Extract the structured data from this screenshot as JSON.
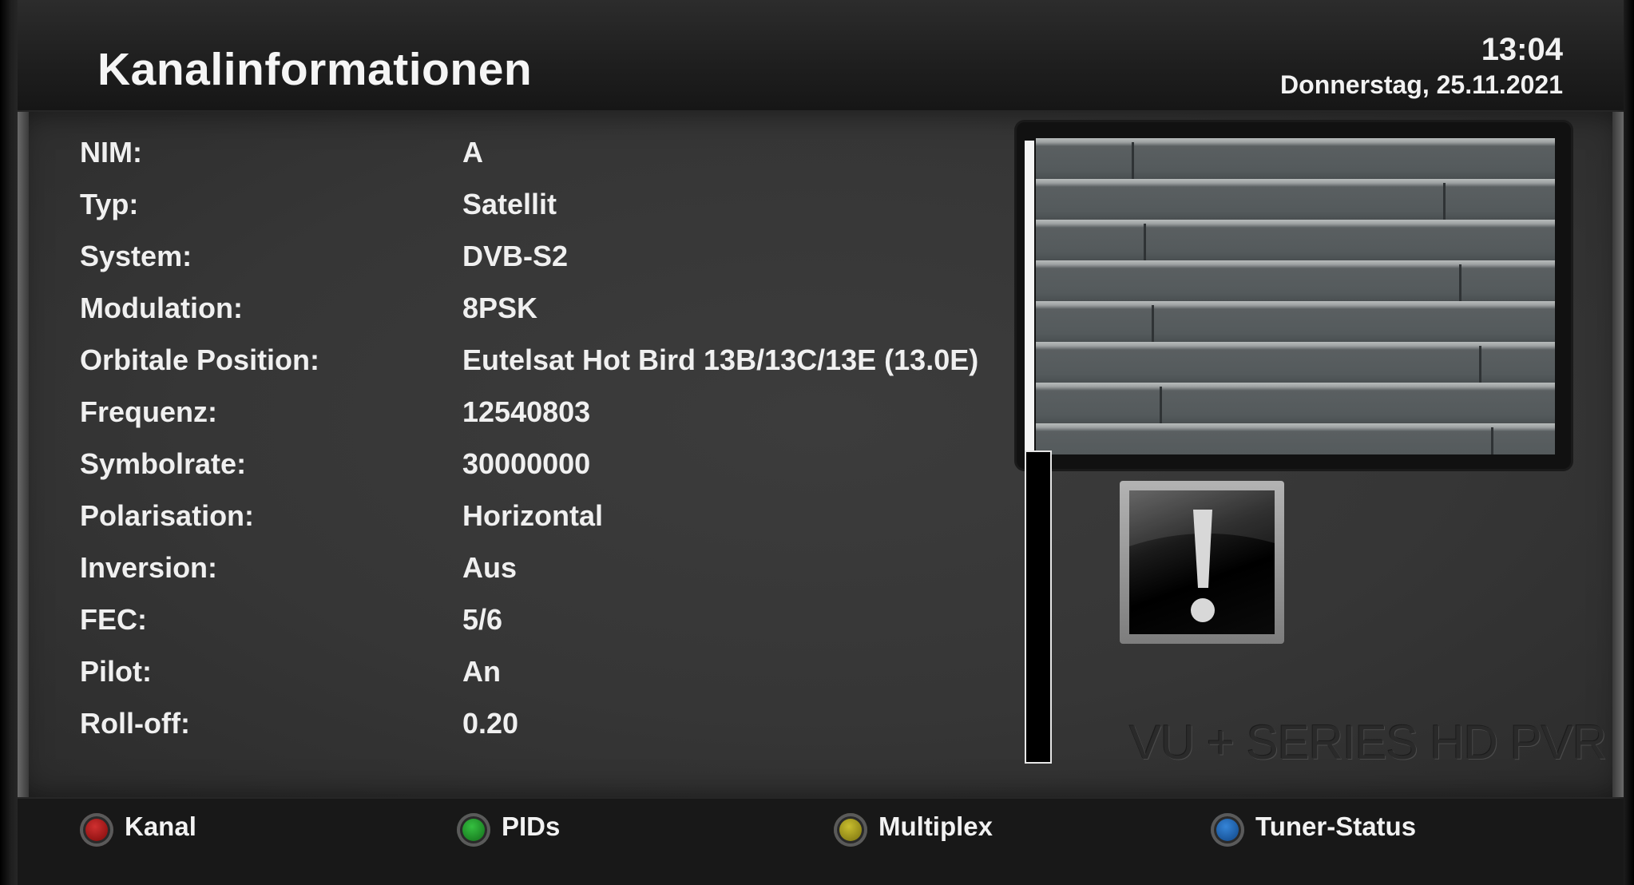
{
  "header": {
    "title": "Kanalinformationen",
    "time": "13:04",
    "date": "Donnerstag, 25.11.2021"
  },
  "info_rows": [
    {
      "label": "NIM:",
      "value": "A"
    },
    {
      "label": "Typ:",
      "value": "Satellit"
    },
    {
      "label": "System:",
      "value": "DVB-S2"
    },
    {
      "label": "Modulation:",
      "value": "8PSK"
    },
    {
      "label": "Orbitale Position:",
      "value": "Eutelsat Hot Bird 13B/13C/13E (13.0E)"
    },
    {
      "label": "Frequenz:",
      "value": "12540803"
    },
    {
      "label": "Symbolrate:",
      "value": "30000000"
    },
    {
      "label": "Polarisation:",
      "value": "Horizontal"
    },
    {
      "label": "Inversion:",
      "value": "Aus"
    },
    {
      "label": "FEC:",
      "value": "5/6"
    },
    {
      "label": "Pilot:",
      "value": "An"
    },
    {
      "label": "Roll-off:",
      "value": "0.20"
    }
  ],
  "brand": "VU + SERIES HD PVR",
  "warning_icon": "exclamation-icon",
  "footer_buttons": [
    {
      "label": "Kanal",
      "color": "#b01818",
      "icon": "red-button-icon"
    },
    {
      "label": "PIDs",
      "color": "#1d9a2a",
      "icon": "green-button-icon"
    },
    {
      "label": "Multiplex",
      "color": "#a9a01e",
      "icon": "yellow-button-icon"
    },
    {
      "label": "Tuner-Status",
      "color": "#1e64b4",
      "icon": "blue-button-icon"
    }
  ]
}
